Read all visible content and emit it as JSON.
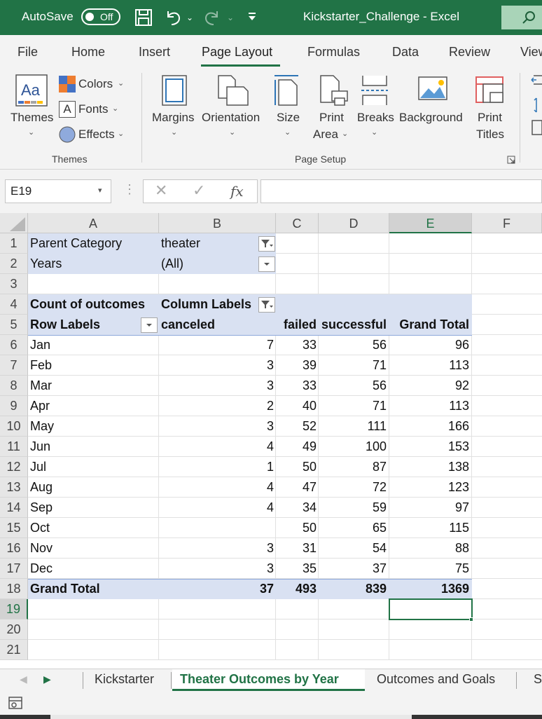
{
  "titlebar": {
    "autosave_label": "AutoSave",
    "autosave_state": "Off",
    "document_title": "Kickstarter_Challenge  -  Excel"
  },
  "menu": {
    "tabs": [
      "File",
      "Home",
      "Insert",
      "Page Layout",
      "Formulas",
      "Data",
      "Review",
      "View"
    ],
    "active": "Page Layout"
  },
  "ribbon": {
    "themes_group": {
      "themes_label": "Themes",
      "colors_label": "Colors",
      "fonts_label": "Fonts",
      "effects_label": "Effects",
      "group_label": "Themes"
    },
    "page_setup_group": {
      "margins": "Margins",
      "orientation": "Orientation",
      "size": "Size",
      "print_area_1": "Print",
      "print_area_2": "Area",
      "breaks": "Breaks",
      "background": "Background",
      "print_titles_1": "Print",
      "print_titles_2": "Titles",
      "group_label": "Page Setup"
    }
  },
  "formula_bar": {
    "name_box": "E19",
    "fx_symbol": "fx",
    "formula": ""
  },
  "grid": {
    "columns": [
      "A",
      "B",
      "C",
      "D",
      "E",
      "F"
    ],
    "rows": [
      "1",
      "2",
      "3",
      "4",
      "5",
      "6",
      "7",
      "8",
      "9",
      "10",
      "11",
      "12",
      "13",
      "14",
      "15",
      "16",
      "17",
      "18",
      "19",
      "20",
      "21"
    ],
    "filters": {
      "parent_category_label": "Parent Category",
      "parent_category_value": "theater",
      "years_label": "Years",
      "years_value": "(All)"
    },
    "pivot": {
      "corner_label": "Count of outcomes",
      "column_labels": "Column Labels",
      "row_labels": "Row Labels",
      "headers": [
        "canceled",
        "failed",
        "successful",
        "Grand Total"
      ],
      "rows": [
        {
          "label": "Jan",
          "canceled": "7",
          "failed": "33",
          "successful": "56",
          "total": "96"
        },
        {
          "label": "Feb",
          "canceled": "3",
          "failed": "39",
          "successful": "71",
          "total": "113"
        },
        {
          "label": "Mar",
          "canceled": "3",
          "failed": "33",
          "successful": "56",
          "total": "92"
        },
        {
          "label": "Apr",
          "canceled": "2",
          "failed": "40",
          "successful": "71",
          "total": "113"
        },
        {
          "label": "May",
          "canceled": "3",
          "failed": "52",
          "successful": "111",
          "total": "166"
        },
        {
          "label": "Jun",
          "canceled": "4",
          "failed": "49",
          "successful": "100",
          "total": "153"
        },
        {
          "label": "Jul",
          "canceled": "1",
          "failed": "50",
          "successful": "87",
          "total": "138"
        },
        {
          "label": "Aug",
          "canceled": "4",
          "failed": "47",
          "successful": "72",
          "total": "123"
        },
        {
          "label": "Sep",
          "canceled": "4",
          "failed": "34",
          "successful": "59",
          "total": "97"
        },
        {
          "label": "Oct",
          "canceled": "",
          "failed": "50",
          "successful": "65",
          "total": "115"
        },
        {
          "label": "Nov",
          "canceled": "3",
          "failed": "31",
          "successful": "54",
          "total": "88"
        },
        {
          "label": "Dec",
          "canceled": "3",
          "failed": "35",
          "successful": "37",
          "total": "75"
        }
      ],
      "grand_total": {
        "label": "Grand Total",
        "canceled": "37",
        "failed": "493",
        "successful": "839",
        "total": "1369"
      }
    },
    "selected_cell": "E19"
  },
  "sheet_tabs": {
    "tabs": [
      "Kickstarter",
      "Theater Outcomes by Year",
      "Outcomes and Goals",
      "S"
    ],
    "active": "Theater Outcomes by Year"
  },
  "colors": {
    "excel_green": "#217346",
    "pivot_band": "#d9e1f2"
  }
}
